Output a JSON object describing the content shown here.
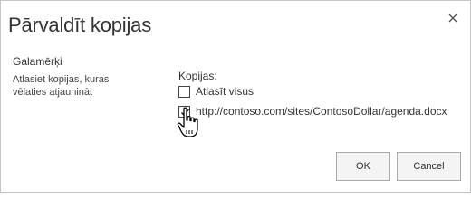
{
  "dialog": {
    "title": "Pārvaldīt kopijas",
    "close_icon": "close-icon"
  },
  "destinations": {
    "heading": "Galamērķi",
    "description": "Atlasiet kopijas, kuras vēlaties atjaunināt"
  },
  "copies": {
    "label": "Kopijas:",
    "select_all": {
      "label": "Atlasīt visus",
      "checked": false
    },
    "items": [
      {
        "label": "http://contoso.com/sites/ContosoDollar/agenda.docx",
        "checked": true
      }
    ]
  },
  "buttons": {
    "ok": "OK",
    "cancel": "Cancel"
  },
  "cursor_icon": "hand-pointer-icon"
}
